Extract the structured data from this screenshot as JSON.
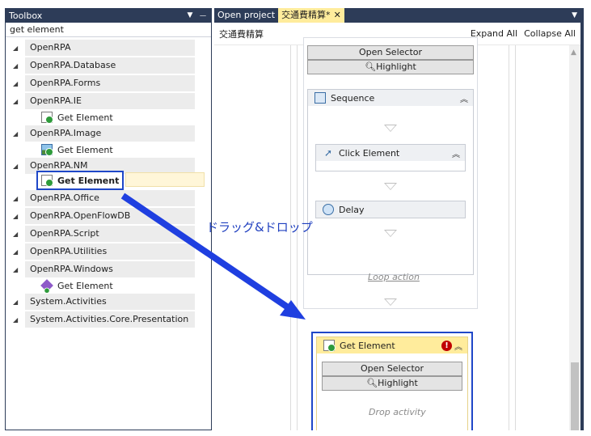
{
  "toolbox": {
    "title": "Toolbox",
    "search_value": "get element",
    "categories": [
      {
        "label": "OpenRPA"
      },
      {
        "label": "OpenRPA.Database"
      },
      {
        "label": "OpenRPA.Forms"
      },
      {
        "label": "OpenRPA.IE",
        "item": "Get Element"
      },
      {
        "label": "OpenRPA.Image",
        "item": "Get Element"
      },
      {
        "label": "OpenRPA.NM",
        "item": "Get Element"
      },
      {
        "label": "OpenRPA.Office"
      },
      {
        "label": "OpenRPA.OpenFlowDB"
      },
      {
        "label": "OpenRPA.Script"
      },
      {
        "label": "OpenRPA.Utilities"
      },
      {
        "label": "OpenRPA.Windows",
        "item": "Get Element"
      },
      {
        "label": "System.Activities"
      },
      {
        "label": "System.Activities.Core.Presentation"
      }
    ]
  },
  "designer": {
    "tabs": [
      {
        "label": "Open project"
      },
      {
        "label": "交通費精算*",
        "close": "✕"
      }
    ],
    "breadcrumb": "交通費精算",
    "expand_all": "Expand All",
    "collapse_all": "Collapse All",
    "open_selector": "Open Selector",
    "highlight": "Highlight",
    "sequence_title": "Sequence",
    "click_element_title": "Click Element",
    "delay_title": "Delay",
    "loop_action": "Loop action",
    "get_element_title": "Get Element",
    "drop_activity": "Drop activity"
  },
  "annotation": {
    "label": "ドラッグ&ドロップ",
    "color": "#1f3fbf"
  },
  "colors": {
    "titlebar": "#2d3c58",
    "active_tab": "#ffec9c",
    "highlight_border": "#1f47c8"
  }
}
